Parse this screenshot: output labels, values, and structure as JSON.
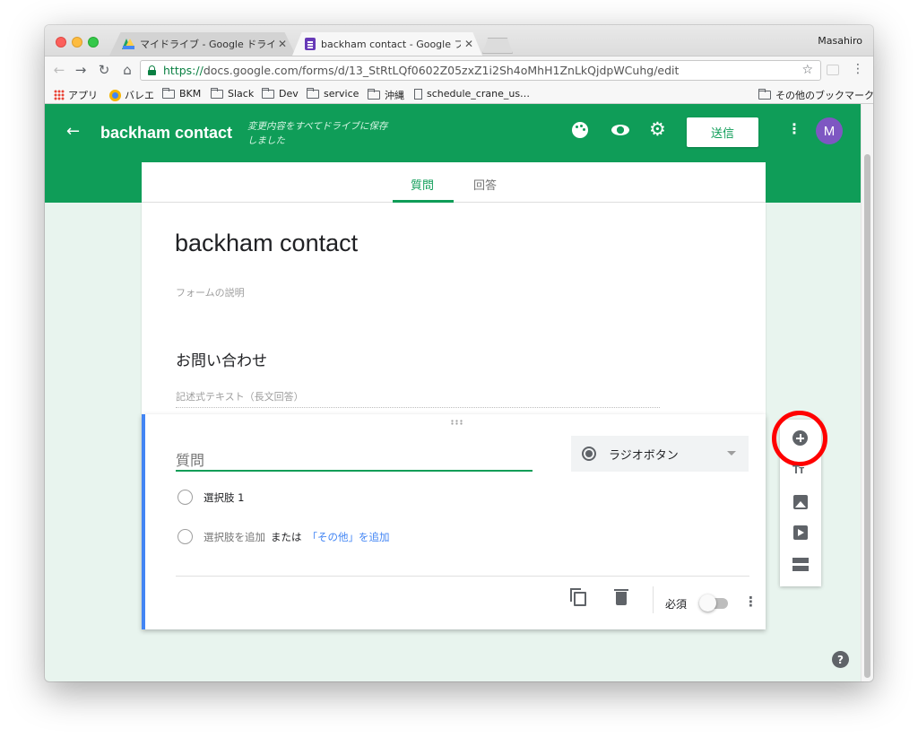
{
  "browser": {
    "tabs": [
      {
        "title": "マイドライブ - Google ドライブ",
        "close": "✕",
        "icon": "google-drive-icon"
      },
      {
        "title": "backham contact - Google フォ",
        "close": "✕",
        "icon": "google-forms-icon"
      }
    ],
    "profile_name": "Masahiro",
    "url_scheme": "https://",
    "url_rest": "docs.google.com/forms/d/13_StRtLQf0602Z05zxZ1i2Sh4oMhH1ZnLkQjdpWCuhg/edit",
    "bookmarks": [
      "アプリ",
      "バレエ",
      "BKM",
      "Slack",
      "Dev",
      "service",
      "沖縄",
      "schedule_crane_us…"
    ],
    "other_bookmarks": "その他のブックマーク"
  },
  "header": {
    "form_name": "backham contact",
    "save_status": "変更内容をすべてドライブに保存しました",
    "send_label": "送信",
    "avatar_initial": "M",
    "accent_color": "#0f9d58"
  },
  "tabs": {
    "questions": "質問",
    "responses": "回答"
  },
  "form": {
    "title": "backham contact",
    "description_placeholder": "フォームの説明",
    "section_title": "お問い合わせ",
    "long_answer_hint": "記述式テキスト（長文回答）"
  },
  "question": {
    "title_placeholder": "質問",
    "type": "ラジオボタン",
    "option1": "選択肢 1",
    "add_option": "選択肢を追加",
    "or": "または",
    "add_other": "「その他」を追加",
    "required_label": "必須",
    "required": false
  },
  "side_toolbar": {
    "items": [
      "add-question",
      "add-title-and-description",
      "add-image",
      "add-video",
      "add-section"
    ],
    "highlighted": "add-question",
    "highlight_color": "#ff0000"
  },
  "icons": {
    "title_text_glyph": "Tт",
    "help_glyph": "?"
  }
}
